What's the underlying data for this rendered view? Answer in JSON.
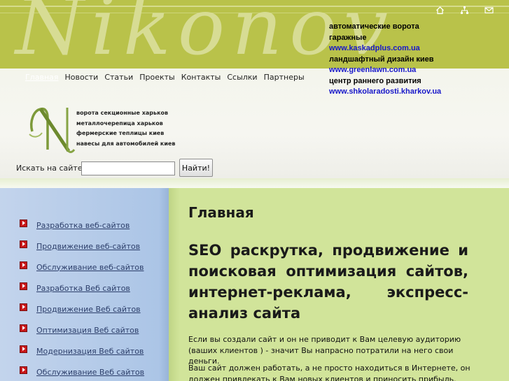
{
  "header": {
    "watermark": "Nikonov",
    "icons": [
      "home-icon",
      "sitemap-icon",
      "mail-icon"
    ]
  },
  "promo": [
    {
      "text": "автоматические ворота",
      "link": false
    },
    {
      "text": "гаражные",
      "link": false
    },
    {
      "text": "www.kaskadplus.com.ua",
      "link": true
    },
    {
      "text": "ландшафтный дизайн киев",
      "link": false
    },
    {
      "text": "www.greenlawn.com.ua",
      "link": true
    },
    {
      "text": "центр раннего развития",
      "link": false
    },
    {
      "text": "www.shkolaradosti.kharkov.ua",
      "link": true
    }
  ],
  "nav": [
    "Главная",
    "Новости",
    "Статьи",
    "Проекты",
    "Контакты",
    "Ссылки",
    "Партнеры"
  ],
  "keywords": [
    "ворота секционные харьков",
    "металлочерепица харьков",
    "фермерские теплицы киев",
    "навесы для автомобилей киев"
  ],
  "search": {
    "label": "Искать на сайте:",
    "value": "",
    "button": "Найти!"
  },
  "sidebar": [
    "Разработка веб-сайтов",
    "Продвижение веб-сайтов",
    "Обслуживание веб-сайтов",
    "Разработка Веб сайтов",
    "Продвижение Веб сайтов",
    "Оптимизация Веб сайтов",
    "Модернизация Веб сайтов",
    "Обслуживание Веб сайтов"
  ],
  "main": {
    "title": "Главная",
    "headline": "SEO раскрутка, продвижение и поисковая оптимизация сайтов, интернет-реклама, экспресс-анализ сайта",
    "p1": "Если вы создали сайт и он не приводит к Вам целевую аудиторию  (ваших клиентов ) - значит Вы напрасно потратили на него свои деньги.",
    "p2": "Ваш сайт должен работать, а не просто находиться в Интернете, он должен привлекать к Вам новых клиентов и приносить прибыль."
  },
  "colors": {
    "header": "#b9c24a",
    "sidebar": "#aac4e6",
    "main": "#d1e49a",
    "link": "#1717c9"
  }
}
